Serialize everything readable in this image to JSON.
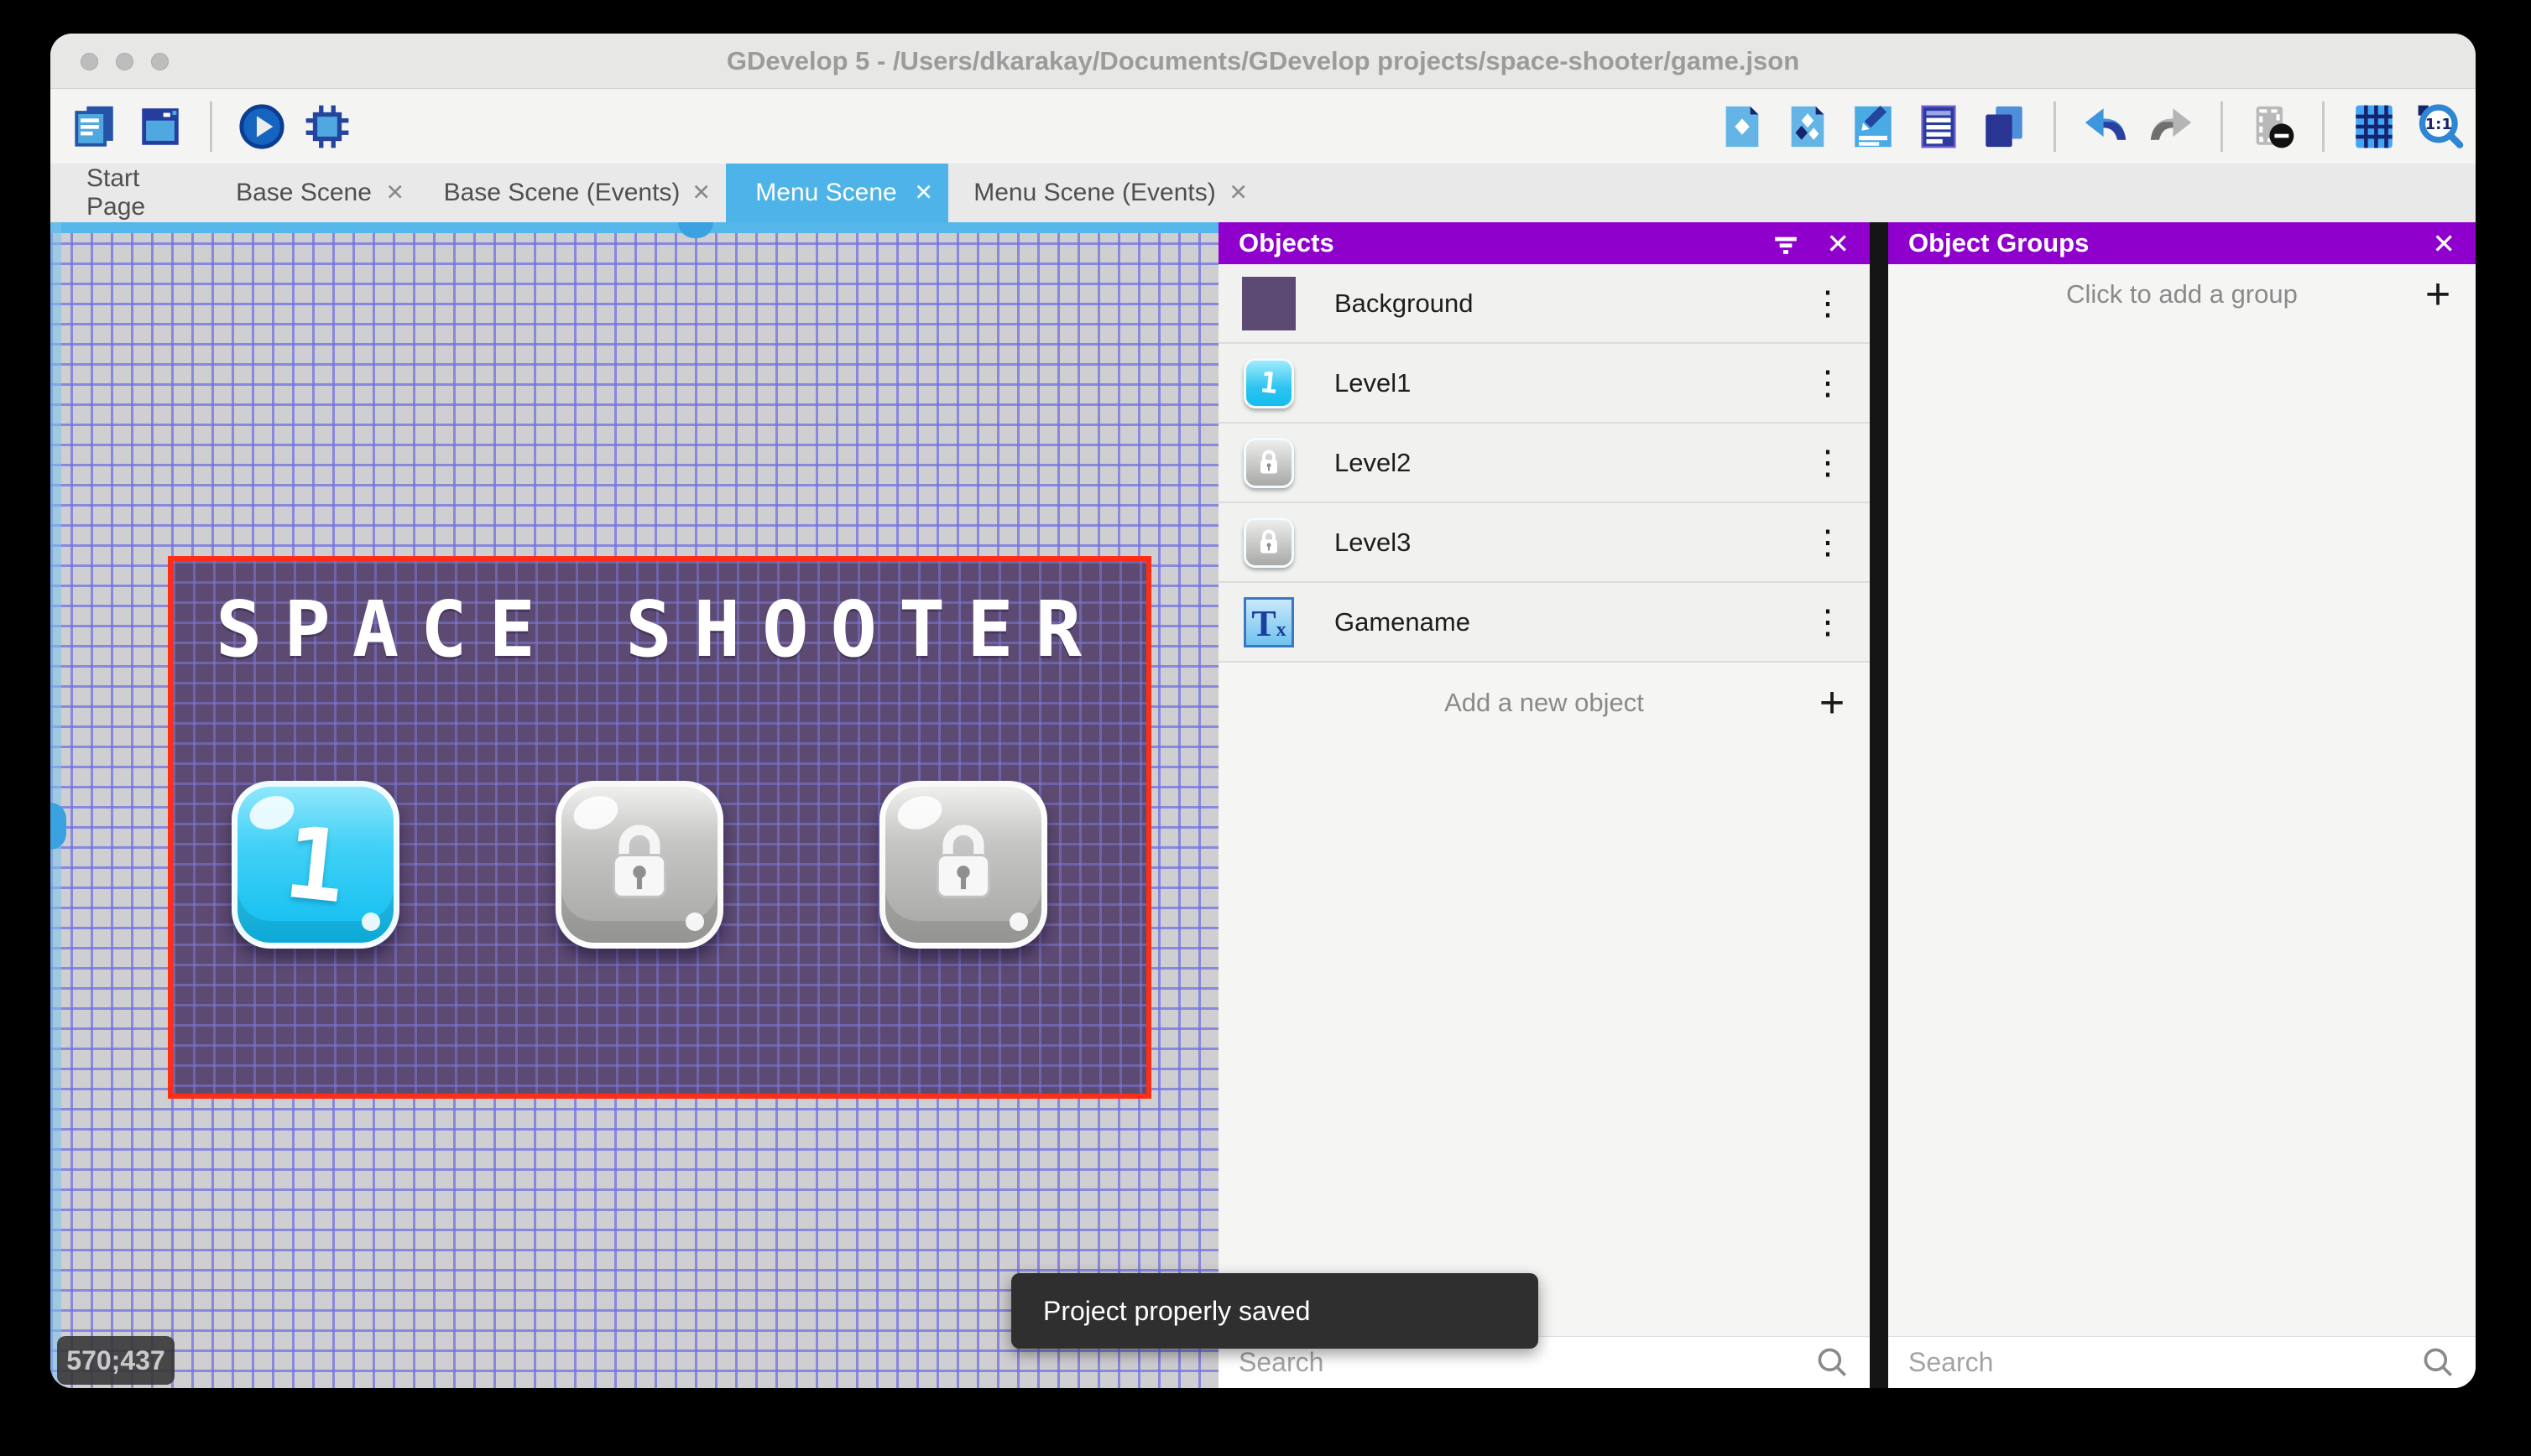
{
  "window": {
    "title": "GDevelop 5 - /Users/dkarakay/Documents/GDevelop projects/space-shooter/game.json"
  },
  "toolbar": {
    "left_icons": [
      "project-manager",
      "scene-window",
      "preview-play",
      "debug"
    ],
    "right_icons": [
      "objects-editor",
      "object-groups-editor",
      "properties",
      "instances-list",
      "layers",
      "undo",
      "redo",
      "window-mask",
      "grid",
      "zoom-original"
    ]
  },
  "tabs": [
    {
      "label": "Start Page",
      "closable": false,
      "active": false
    },
    {
      "label": "Base Scene",
      "closable": true,
      "active": false
    },
    {
      "label": "Base Scene (Events)",
      "closable": true,
      "active": false
    },
    {
      "label": "Menu Scene",
      "closable": true,
      "active": true
    },
    {
      "label": "Menu Scene (Events)",
      "closable": true,
      "active": false
    },
    {
      "close_glyph": "✕"
    }
  ],
  "canvas": {
    "coordinates": "570;437",
    "scene": {
      "title": "SPACE SHOOTER",
      "level_buttons": [
        {
          "label": "1",
          "state": "unlocked"
        },
        {
          "label": "",
          "state": "locked"
        },
        {
          "label": "",
          "state": "locked"
        }
      ]
    }
  },
  "objects_panel": {
    "title": "Objects",
    "items": [
      {
        "name": "Background",
        "thumb": "background-swatch"
      },
      {
        "name": "Level1",
        "thumb": "level1-button"
      },
      {
        "name": "Level2",
        "thumb": "locked-button"
      },
      {
        "name": "Level3",
        "thumb": "locked-button"
      },
      {
        "name": "Gamename",
        "thumb": "text-object"
      }
    ],
    "add_label": "Add a new object",
    "search_placeholder": "Search"
  },
  "groups_panel": {
    "title": "Object Groups",
    "empty_label": "Click to add a group",
    "search_placeholder": "Search"
  },
  "toast": {
    "message": "Project properly saved"
  },
  "colors": {
    "panel_header_purple": "#9000cd",
    "active_tab_blue": "#4db3e8",
    "scene_border_red": "#ff2d16",
    "scene_bg_purple": "#5d4a73",
    "canvas_bg": "#cfcfd2",
    "grid_line": "#7070e0",
    "toast_bg": "#2f2f2f"
  }
}
